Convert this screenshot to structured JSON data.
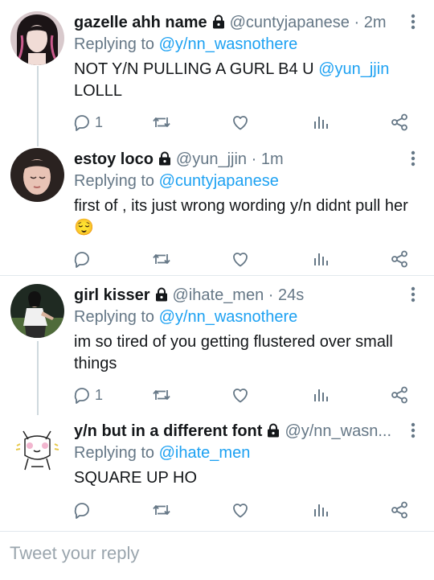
{
  "tweets": [
    {
      "name": "gazelle ahh name",
      "handle": "@cuntyjapanese",
      "time": "2m",
      "replying_prefix": "Replying to ",
      "replying_to": "@y/nn_wasnothere",
      "body_before": "NOT Y/N PULLING A GURL B4 U ",
      "body_mention": "@yun_jjin",
      "body_line2": "LOLLL",
      "reply_count": "1"
    },
    {
      "name": "estoy loco",
      "handle": "@yun_jjin",
      "time": "1m",
      "replying_prefix": "Replying to ",
      "replying_to": "@cuntyjapanese",
      "body": "first of , its just wrong wording y/n didnt pull her",
      "emoji": "😌",
      "reply_count": ""
    },
    {
      "name": "girl kisser",
      "handle": "@ihate_men",
      "time": "24s",
      "replying_prefix": "Replying to ",
      "replying_to": "@y/nn_wasnothere",
      "body": "im so tired of you getting flustered over small things",
      "reply_count": "1"
    },
    {
      "name": "y/n but in a different font",
      "handle": "@y/nn_wasn...",
      "time": "",
      "replying_prefix": "Replying to ",
      "replying_to": "@ihate_men",
      "body": "SQUARE UP HO",
      "reply_count": ""
    }
  ],
  "composer": {
    "placeholder": "Tweet your reply"
  },
  "colors": {
    "link": "#1da1f2",
    "muted": "#657786",
    "text": "#14171a",
    "divider": "#e1e8ed"
  }
}
